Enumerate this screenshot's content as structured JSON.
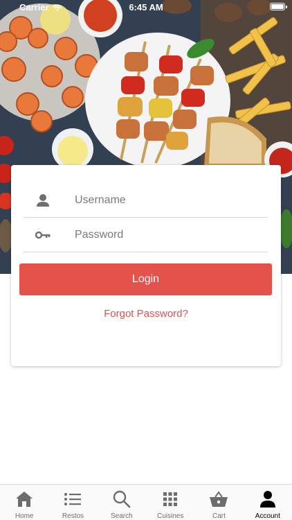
{
  "status_bar": {
    "carrier": "Carrier",
    "time": "6:45 AM"
  },
  "login": {
    "username_placeholder": "Username",
    "password_placeholder": "Password",
    "login_label": "Login",
    "forgot_label": "Forgot Password?"
  },
  "colors": {
    "accent": "#e3524b",
    "tab_active": "#000000",
    "tab_inactive": "#6d6d6d"
  },
  "tab_bar": {
    "items": [
      {
        "label": "Home",
        "icon": "home-icon"
      },
      {
        "label": "Restos",
        "icon": "list-icon"
      },
      {
        "label": "Search",
        "icon": "search-icon"
      },
      {
        "label": "Cuisines",
        "icon": "grid-icon"
      },
      {
        "label": "Cart",
        "icon": "basket-icon"
      },
      {
        "label": "Account",
        "icon": "person-icon",
        "active": true
      }
    ]
  }
}
